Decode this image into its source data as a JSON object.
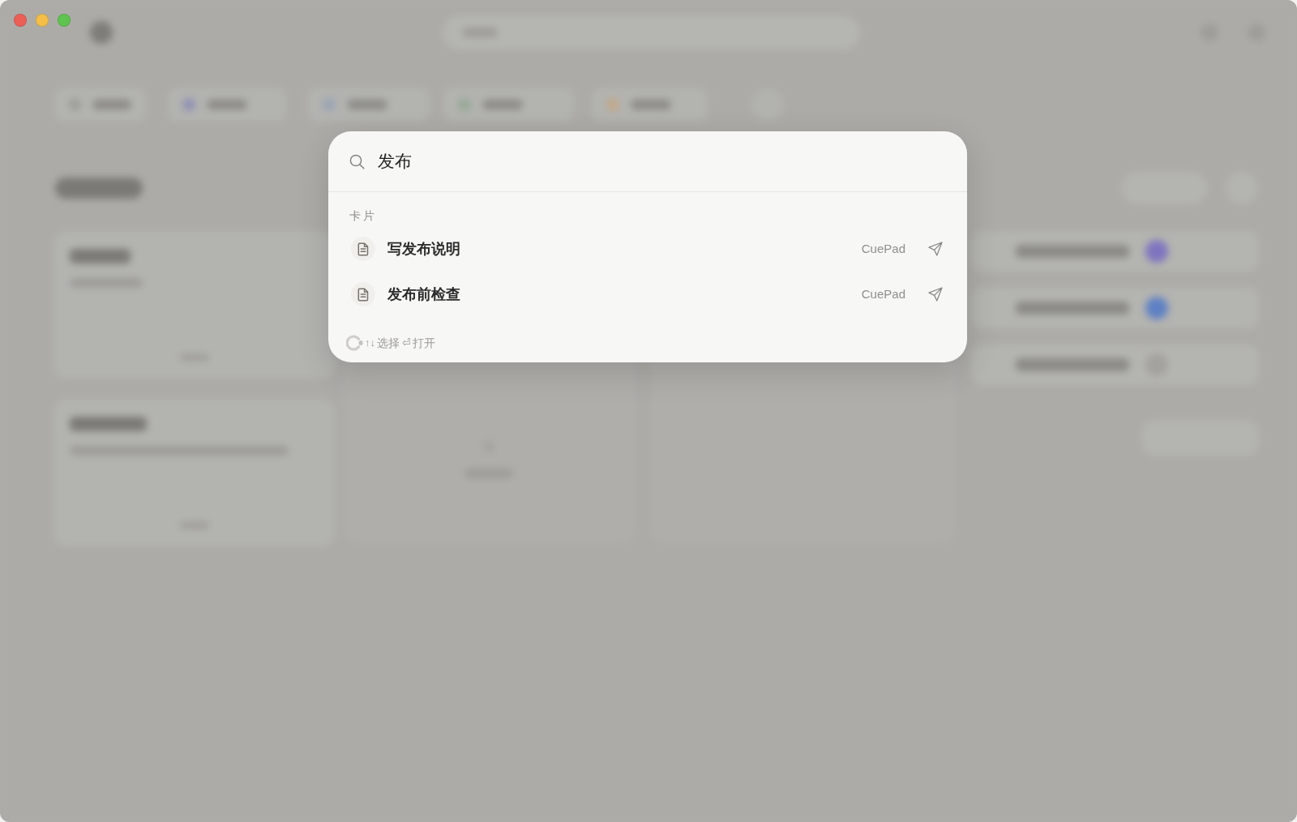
{
  "window": {
    "controls": [
      {
        "kind": "close"
      },
      {
        "kind": "minimize"
      },
      {
        "kind": "zoom"
      }
    ]
  },
  "backdrop": {
    "blurred": true,
    "tabs": [
      {
        "color": "#9c9c99"
      },
      {
        "color": "#8f90b4"
      },
      {
        "color": "#98a4b3"
      },
      {
        "color": "#94a995"
      },
      {
        "color": "#c2a888"
      }
    ],
    "list_rows": [
      {
        "color": "#7e74c0"
      },
      {
        "color": "#5f80c4"
      },
      {
        "color": "#a3a29e"
      }
    ]
  },
  "palette": {
    "query": "发布",
    "sections": [
      {
        "title": "卡片",
        "items": [
          {
            "title": "写发布说明",
            "source": "CuePad",
            "selected": false
          },
          {
            "title": "发布前检查",
            "source": "CuePad",
            "selected": false
          }
        ]
      }
    ],
    "hints": [
      {
        "keys": "↑↓",
        "label": "选择"
      },
      {
        "keys": "⏎",
        "label": "打开"
      }
    ]
  }
}
